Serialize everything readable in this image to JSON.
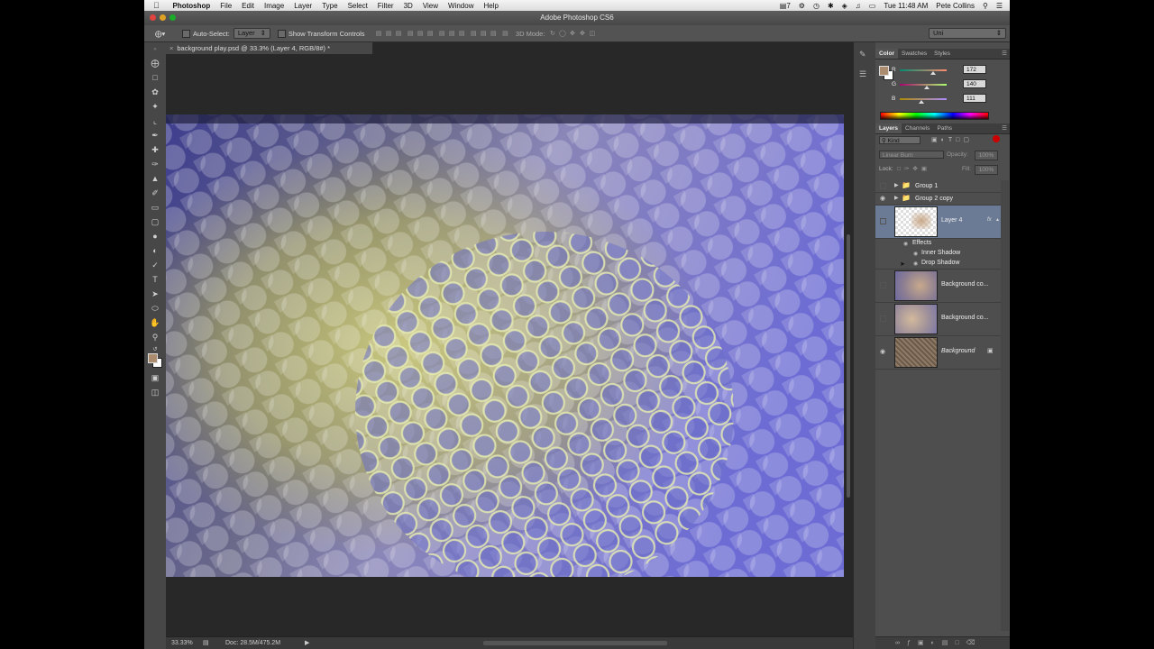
{
  "menubar": {
    "app_name": "Photoshop",
    "items": [
      "File",
      "Edit",
      "Image",
      "Layer",
      "Type",
      "Select",
      "Filter",
      "3D",
      "View",
      "Window",
      "Help"
    ],
    "status": {
      "notifications": "7",
      "time": "Tue 11:48 AM",
      "user": "Pete Collins"
    }
  },
  "window": {
    "title": "Adobe Photoshop CS6"
  },
  "options_bar": {
    "auto_select_label": "Auto-Select:",
    "auto_select_value": "Layer",
    "transform_controls_label": "Show Transform Controls",
    "three_d_mode_label": "3D Mode:",
    "workspace_value": "Uni"
  },
  "document": {
    "tab_title": "background play.psd @ 33.3% (Layer 4, RGB/8#) *",
    "zoom": "33.33%",
    "doc_size": "Doc: 28.5M/475.2M"
  },
  "color_panel": {
    "tabs": [
      "Color",
      "Swatches",
      "Styles"
    ],
    "r_label": "R",
    "g_label": "G",
    "b_label": "B",
    "r": "172",
    "g": "140",
    "b": "111",
    "foreground_color": "#ac8c6f"
  },
  "layers_panel": {
    "tabs": [
      "Layers",
      "Channels",
      "Paths"
    ],
    "filter_value": "Kind",
    "blend_mode": "Linear Burn",
    "opacity_label": "Opacity:",
    "opacity_value": "100%",
    "lock_label": "Lock:",
    "fill_label": "Fill:",
    "fill_value": "100%",
    "groups": [
      "Group 1",
      "Group 2 copy"
    ],
    "selected_layer": "Layer 4",
    "effects_label": "Effects",
    "effects": [
      "Inner Shadow",
      "Drop Shadow"
    ],
    "layers": [
      "Background co...",
      "Background co...",
      "Background"
    ],
    "fx_label": "fx"
  }
}
